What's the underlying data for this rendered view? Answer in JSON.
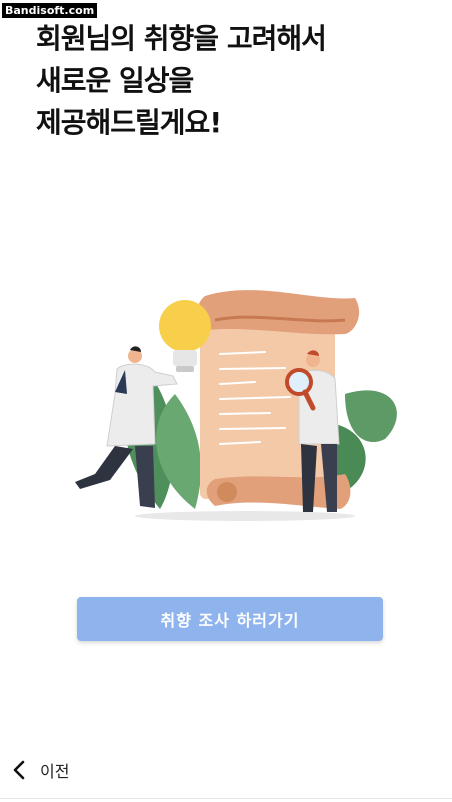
{
  "watermark": "Bandisoft.com",
  "headline": {
    "line1": "회원님의 취향을 고려해서",
    "line2": "새로운 일상을",
    "line3": "제공해드릴게요!"
  },
  "illustration": {
    "icon": "scientists-scroll-illustration"
  },
  "cta": {
    "label": "취향 조사 하러가기",
    "color": "#8fb3ec"
  },
  "footer": {
    "back_icon": "chevron-left-icon",
    "back_label": "이전"
  }
}
